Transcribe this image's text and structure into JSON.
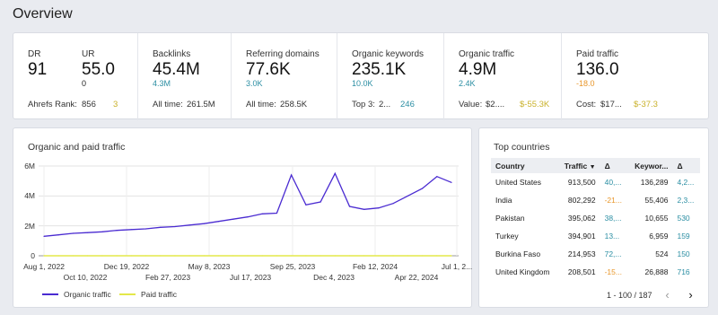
{
  "page_title": "Overview",
  "metrics": {
    "dr": {
      "label": "DR",
      "value": "91"
    },
    "ur": {
      "label": "UR",
      "value": "55.0",
      "sub": "0"
    },
    "ahrefs_rank": {
      "label": "Ahrefs Rank:",
      "value": "856",
      "change": "3"
    },
    "backlinks": {
      "label": "Backlinks",
      "value": "45.4M",
      "change": "4.3M",
      "foot_label": "All time:",
      "foot_value": "261.5M"
    },
    "referring_domains": {
      "label": "Referring domains",
      "value": "77.6K",
      "change": "3.0K",
      "foot_label": "All time:",
      "foot_value": "258.5K"
    },
    "organic_keywords": {
      "label": "Organic keywords",
      "value": "235.1K",
      "change": "10.0K",
      "foot_label": "Top 3:",
      "foot_value": "2...",
      "foot_change": "246"
    },
    "organic_traffic": {
      "label": "Organic traffic",
      "value": "4.9M",
      "change": "2.4K",
      "foot_label": "Value:",
      "foot_value": "$2....",
      "foot_change": "$-55.3K"
    },
    "paid_traffic": {
      "label": "Paid traffic",
      "value": "136.0",
      "change": "-18.0",
      "foot_label": "Cost:",
      "foot_value": "$17...",
      "foot_change": "$-37.3"
    }
  },
  "chart_card": {
    "title": "Organic and paid traffic"
  },
  "chart_data": {
    "type": "line",
    "title": "Organic and paid traffic",
    "ylim": [
      0,
      6000000
    ],
    "y_ticks": [
      "0",
      "2M",
      "4M",
      "6M"
    ],
    "x_ticks_top": [
      "Aug 1, 2022",
      "Dec 19, 2022",
      "May 8, 2023",
      "Sep 25, 2023",
      "Feb 12, 2024",
      "Jul 1, 2..."
    ],
    "x_ticks_bottom": [
      "Oct 10, 2022",
      "Feb 27, 2023",
      "Jul 17, 2023",
      "Dec 4, 2023",
      "Apr 22, 2024"
    ],
    "x": [
      "2022-08",
      "2022-09",
      "2022-10",
      "2022-11",
      "2022-12",
      "2023-01",
      "2023-02",
      "2023-03",
      "2023-04",
      "2023-05",
      "2023-06",
      "2023-07",
      "2023-08",
      "2023-09",
      "2023-10",
      "2023-11",
      "2023-12",
      "2023-12b",
      "2023-12c",
      "2024-01",
      "2024-01b",
      "2024-01c",
      "2024-02",
      "2024-03",
      "2024-04",
      "2024-05",
      "2024-06",
      "2024-06b",
      "2024-07"
    ],
    "series": [
      {
        "name": "Organic traffic",
        "color": "#4a2bd1",
        "values": [
          1300000,
          1400000,
          1500000,
          1550000,
          1600000,
          1700000,
          1750000,
          1800000,
          1900000,
          1950000,
          2050000,
          2150000,
          2300000,
          2450000,
          2600000,
          2800000,
          2850000,
          5400000,
          3400000,
          3600000,
          5500000,
          3300000,
          3100000,
          3200000,
          3500000,
          4000000,
          4500000,
          5300000,
          4900000
        ]
      },
      {
        "name": "Paid traffic",
        "color": "#e3e84a",
        "values": [
          0,
          0,
          0,
          0,
          0,
          0,
          0,
          0,
          0,
          0,
          0,
          0,
          0,
          0,
          0,
          0,
          0,
          0,
          0,
          0,
          0,
          0,
          0,
          0,
          0,
          0,
          0,
          0,
          0
        ]
      }
    ]
  },
  "countries": {
    "title": "Top countries",
    "headers": [
      "Country",
      "Traffic",
      "Δ",
      "Keywor...",
      "Δ"
    ],
    "sort_icon": "sort-desc-icon",
    "rows": [
      {
        "country": "United States",
        "traffic": "913,500",
        "delta": "40,...",
        "keywords": "136,289",
        "kdelta": "4,2..."
      },
      {
        "country": "India",
        "traffic": "802,292",
        "delta": "-21...",
        "keywords": "55,406",
        "kdelta": "2,3..."
      },
      {
        "country": "Pakistan",
        "traffic": "395,062",
        "delta": "38,...",
        "keywords": "10,655",
        "kdelta": "530"
      },
      {
        "country": "Turkey",
        "traffic": "394,901",
        "delta": "13...",
        "keywords": "6,959",
        "kdelta": "159"
      },
      {
        "country": "Burkina Faso",
        "traffic": "214,953",
        "delta": "72,...",
        "keywords": "524",
        "kdelta": "150"
      },
      {
        "country": "United Kingdom",
        "traffic": "208,501",
        "delta": "-15...",
        "keywords": "26,888",
        "kdelta": "716"
      }
    ],
    "delta_colors": [
      "teal",
      "orange",
      "teal",
      "teal",
      "teal",
      "orange"
    ],
    "pagination": "1 - 100 / 187",
    "prev_icon": "chevron-left-icon",
    "next_icon": "chevron-right-icon"
  }
}
